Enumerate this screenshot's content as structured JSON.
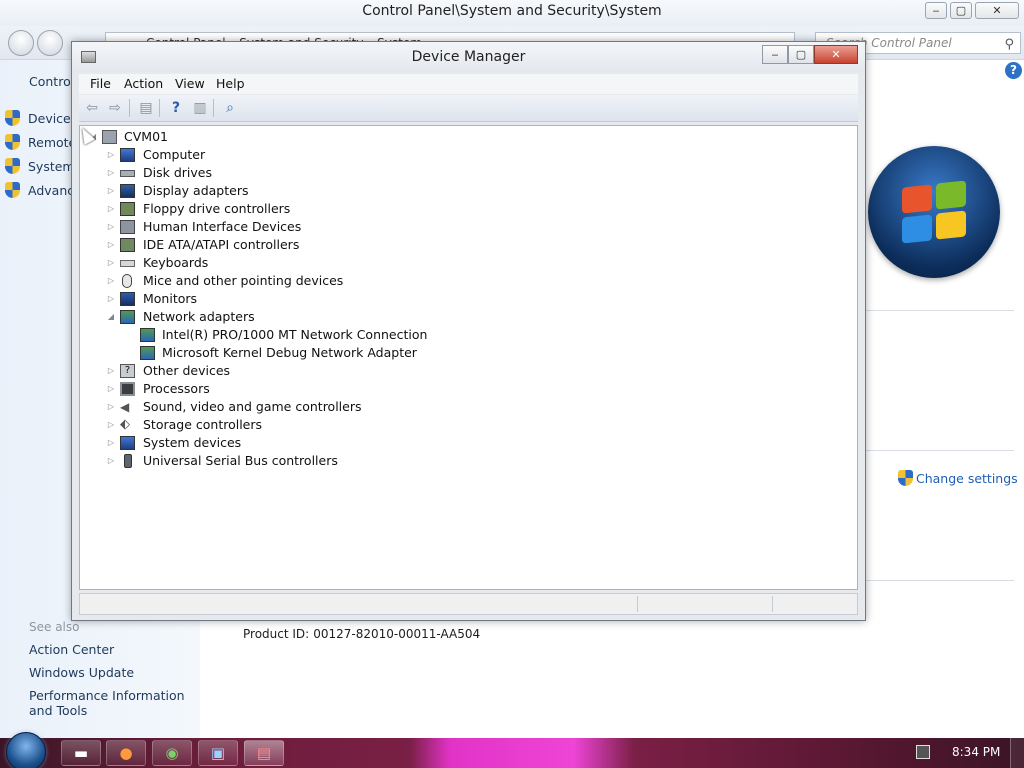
{
  "control_panel": {
    "title": "Control Panel\\System and Security\\System",
    "address": [
      "Control Panel",
      "System and Security",
      "System"
    ],
    "search_placeholder": "Search Control Panel",
    "sidebar_home": "Control Panel Home",
    "sidebar_links": [
      "Device Manager",
      "Remote settings",
      "System protection",
      "Advanced system settings"
    ],
    "see_also": "See also",
    "see_also_links": [
      "Action Center",
      "Windows Update",
      "Performance Information and Tools"
    ],
    "product_id_label": "Product ID:",
    "product_id_value": "00127-82010-00011-AA504",
    "change_settings": "Change settings"
  },
  "device_manager": {
    "title": "Device Manager",
    "menu": [
      "File",
      "Action",
      "View",
      "Help"
    ],
    "toolbar_icons": [
      "back-icon",
      "forward-icon",
      "properties-icon",
      "help-icon",
      "console-tree-icon",
      "scan-hardware-icon"
    ],
    "tree": {
      "root": "CVM01",
      "categories": [
        {
          "label": "Computer",
          "icon": "computer-icon",
          "expanded": false
        },
        {
          "label": "Disk drives",
          "icon": "disk-drive-icon",
          "expanded": false
        },
        {
          "label": "Display adapters",
          "icon": "display-adapter-icon",
          "expanded": false
        },
        {
          "label": "Floppy drive controllers",
          "icon": "floppy-controller-icon",
          "expanded": false
        },
        {
          "label": "Human Interface Devices",
          "icon": "hid-icon",
          "expanded": false
        },
        {
          "label": "IDE ATA/ATAPI controllers",
          "icon": "ide-controller-icon",
          "expanded": false
        },
        {
          "label": "Keyboards",
          "icon": "keyboard-icon",
          "expanded": false
        },
        {
          "label": "Mice and other pointing devices",
          "icon": "mouse-icon",
          "expanded": false
        },
        {
          "label": "Monitors",
          "icon": "monitor-icon",
          "expanded": false
        },
        {
          "label": "Network adapters",
          "icon": "network-adapter-icon",
          "expanded": true,
          "children": [
            "Intel(R) PRO/1000 MT Network Connection",
            "Microsoft Kernel Debug Network Adapter"
          ]
        },
        {
          "label": "Other devices",
          "icon": "unknown-device-icon",
          "expanded": false
        },
        {
          "label": "Processors",
          "icon": "processor-icon",
          "expanded": false
        },
        {
          "label": "Sound, video and game controllers",
          "icon": "speaker-icon",
          "expanded": false
        },
        {
          "label": "Storage controllers",
          "icon": "storage-controller-icon",
          "expanded": false
        },
        {
          "label": "System devices",
          "icon": "system-device-icon",
          "expanded": false
        },
        {
          "label": "Universal Serial Bus controllers",
          "icon": "usb-icon",
          "expanded": false
        }
      ]
    }
  },
  "taskbar": {
    "clock": "8:34 PM",
    "buttons": [
      "file-explorer-icon",
      "firefox-icon",
      "chrome-icon",
      "remote-desktop-icon",
      "device-manager-icon"
    ]
  },
  "colors": {
    "taskbar_accent": "#ee45d6",
    "link": "#1e5fb4",
    "close_button": "#c7422e"
  }
}
